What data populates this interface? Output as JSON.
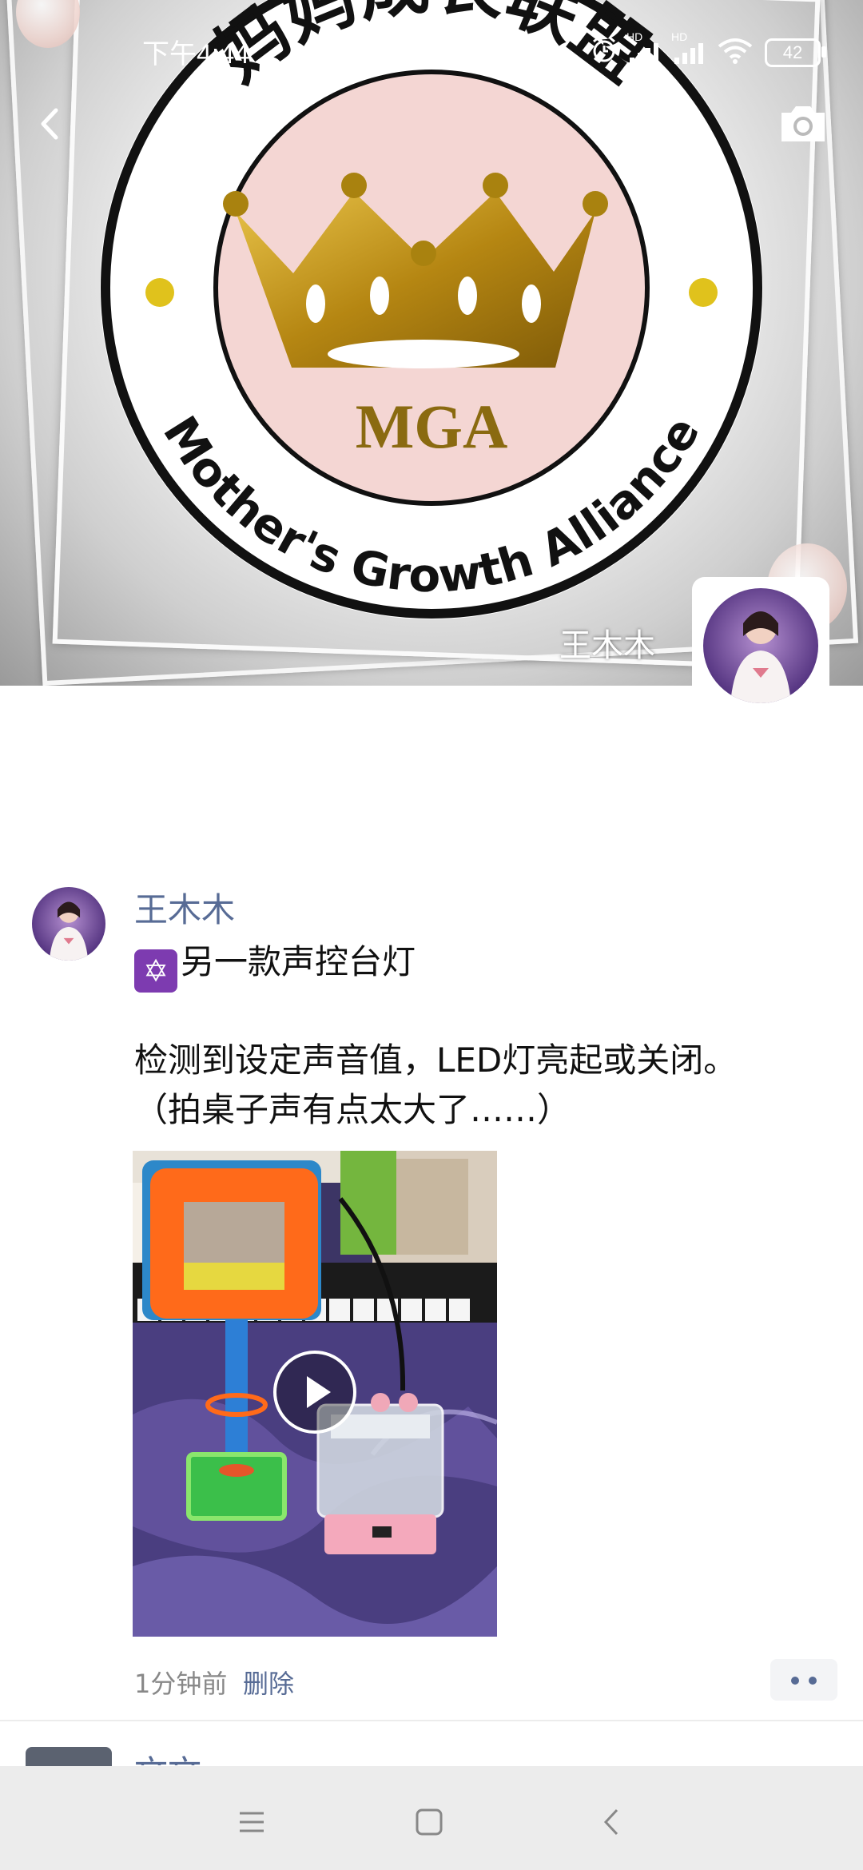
{
  "status_bar": {
    "time": "下午4:44",
    "network_labels": [
      "HD",
      "HD"
    ],
    "battery": "42"
  },
  "cover": {
    "logo": {
      "title_cn": "妈妈成长联盟",
      "title_en": "Mother's Growth Alliance",
      "abbr": "MGA"
    },
    "user_name": "王木木"
  },
  "post": {
    "author": "王木木",
    "title": "另一款声控台灯",
    "emoji": "✡",
    "body_line1": "检测到设定声音值，LED灯亮起或关闭。",
    "body_line2": "（拍桌子声有点太大了……）",
    "time": "1分钟前",
    "delete_label": "删除"
  },
  "next_post": {
    "author_partial": "文文"
  },
  "colors": {
    "link": "#576b95",
    "crown_gold": "#c99a16",
    "logo_pink": "#f4d6d3",
    "nav_bar": "#ececec"
  },
  "icons": [
    "back-arrow-icon",
    "camera-icon",
    "play-icon",
    "more-dots-icon",
    "menu-icon",
    "home-square-icon",
    "nav-back-icon",
    "alarm-icon",
    "signal-icon",
    "wifi-icon",
    "battery-icon"
  ]
}
